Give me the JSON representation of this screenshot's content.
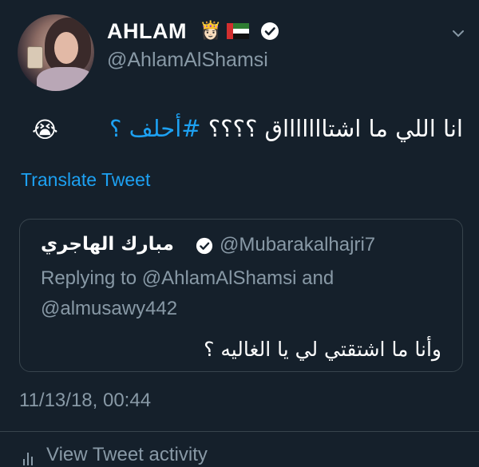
{
  "author": {
    "display_name": "AHLAM",
    "handle": "@AhlamAlShamsi",
    "crown_emoji": "👸🏻",
    "flag_icon": "uae-flag-icon",
    "verified_icon": "verified-badge-icon"
  },
  "tweet": {
    "text": "انا اللي ما اشتاااااااق ؟؟؟؟  ",
    "hashtag": "#أحلف ؟",
    "emoji": "😭",
    "translate_label": "Translate Tweet",
    "timestamp": "11/13/18, 00:44"
  },
  "quoted_tweet": {
    "display_name": "مبارك الهاجري",
    "handle": "@Mubarakalhajri7",
    "replying_line_1": "Replying to @AhlamAlShamsi and",
    "replying_line_2": "@almusawy442",
    "text": "وأنا ما اشتقتي لي يا الغاليه ؟"
  },
  "footer": {
    "activity_label": "View Tweet activity"
  },
  "colors": {
    "background": "#15202b",
    "text": "#ffffff",
    "secondary": "#8899a6",
    "accent": "#1da1f2",
    "border": "#38444d"
  }
}
